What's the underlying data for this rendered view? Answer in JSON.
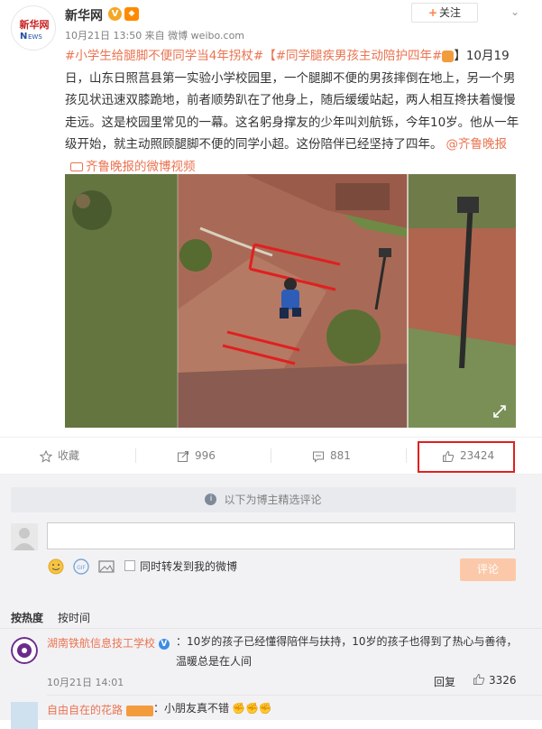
{
  "post": {
    "author": "新华网",
    "verified_mark": "V",
    "meta": "10月21日 13:50 来自 微博 weibo.com",
    "follow_label": "关注",
    "follow_plus": "+",
    "topic1": "#小学生给腿脚不便同学当4年拐杖#",
    "title": "【#同学腿疾男孩主动陪护四年#",
    "title_end": "】",
    "body": "10月19日，山东日照莒县第一实验小学校园里，一个腿脚不便的男孩摔倒在地上，另一个男孩见状迅速双膝跪地，前者顺势趴在了他身上，随后缓缓站起，两人相互搀扶着慢慢走远。这是校园里常见的一幕。这名躬身撑友的少年叫刘航铄，今年10岁。他从一年级开始，就主动照顾腿脚不便的同学小超。这份陪伴已经坚持了四年。",
    "mention": "@齐鲁晚报",
    "video_link": "齐鲁晚报的微博视频"
  },
  "actions": {
    "favorite_label": "收藏",
    "repost_count": "996",
    "comment_count": "881",
    "like_count": "23424"
  },
  "comments_section": {
    "notice": "以下为博主精选评论",
    "sync_label": "同时转发到我的微博",
    "submit_label": "评论",
    "sort_hot": "按热度",
    "sort_time": "按时间"
  },
  "comments": [
    {
      "name": "湖南铁航信息技工学校",
      "text": "：10岁的孩子已经懂得陪伴与扶持，10岁的孩子也得到了热心与善待，温暖总是在人间",
      "time": "10月21日 14:01",
      "reply_label": "回复",
      "likes": "3326"
    },
    {
      "name": "自由自在的花路",
      "text": "：小朋友真不错"
    }
  ],
  "colors": {
    "link": "#eb7350",
    "highlight_box": "#e02020",
    "comment_button": "#fbc9a9"
  }
}
